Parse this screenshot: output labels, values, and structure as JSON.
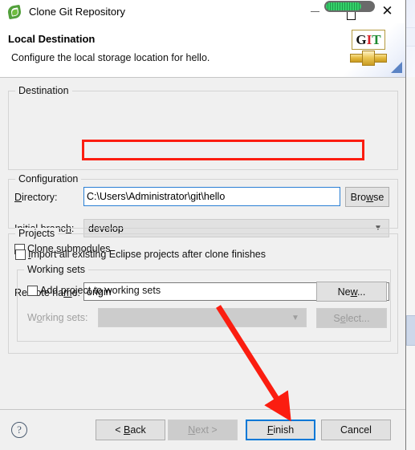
{
  "window": {
    "title": "Clone Git Repository",
    "icon": "eclipse-leaf-icon",
    "minimize_label": "—",
    "maximize_label": "□",
    "close_label": "✕"
  },
  "header": {
    "title": "Local Destination",
    "description": "Configure the local storage location for hello.",
    "logo_text_g": "G",
    "logo_text_i": "I",
    "logo_text_t": "T"
  },
  "destination": {
    "group_title": "Destination",
    "directory_label": "Directory:",
    "directory_value": "C:\\Users\\Administrator\\git\\hello",
    "browse_label": "Browse",
    "initial_branch_label": "Initial branch:",
    "initial_branch_value": "develop",
    "clone_submodules_label": "Clone submodules",
    "clone_submodules_checked": false
  },
  "configuration": {
    "group_title": "Configuration",
    "remote_name_label": "Remote name:",
    "remote_name_value": "origin"
  },
  "projects": {
    "group_title": "Projects",
    "import_label": "Import all existing Eclipse projects after clone finishes",
    "import_checked": false,
    "working_sets": {
      "group_title": "Working sets",
      "add_project_label": "Add project to working sets",
      "add_project_checked": false,
      "new_button_label": "New...",
      "working_sets_label": "Working sets:",
      "working_sets_value": "",
      "select_button_label": "Select...",
      "disabled": true
    }
  },
  "footer": {
    "help_label": "?",
    "back_label": "< Back",
    "next_label": "Next >",
    "finish_label": "Finish",
    "cancel_label": "Cancel",
    "next_disabled": true,
    "finish_focused": true
  },
  "annotations": {
    "highlight_color": "#fb1d10",
    "focus_color": "#0078d7",
    "highlight_target": "initial-branch-combo",
    "arrow_target": "finish-button"
  },
  "overlay": {
    "recorder_label": "recording-progress-indicator",
    "bar_color": "#35d06a",
    "track_color": "#6a6a6a"
  },
  "icons": {
    "chevron_down": "⌄",
    "question": "?"
  }
}
